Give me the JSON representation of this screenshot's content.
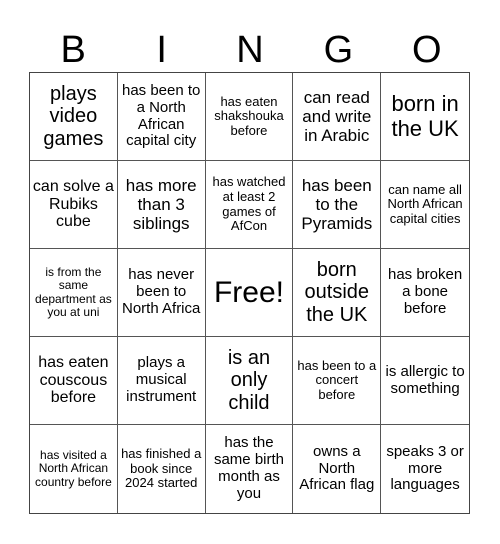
{
  "header": {
    "letters": [
      "B",
      "I",
      "N",
      "G",
      "O"
    ]
  },
  "cells": [
    "plays video games",
    "has been to a North African capital city",
    "has eaten shakshouka before",
    "can read and write in Arabic",
    "born in the UK",
    "can solve a Rubiks cube",
    "has more than 3 siblings",
    "has watched at least 2 games of AfCon",
    "has been to the Pyramids",
    "can name all North African capital cities",
    "is from the same department as you at uni",
    "has never been to North Africa",
    "Free!",
    "born outside the UK",
    "has broken a bone before",
    "has eaten couscous before",
    "plays a musical instrument",
    "is an only child",
    "has been to a concert before",
    "is allergic to something",
    "has visited a North African country before",
    "has finished a book since 2024 started",
    "has the same birth month as you",
    "owns a North African flag",
    "speaks 3 or more languages"
  ]
}
